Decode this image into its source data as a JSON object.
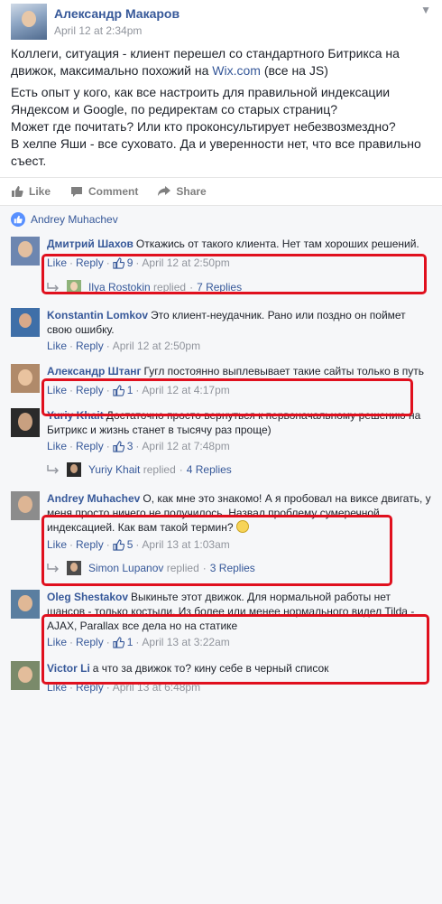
{
  "post": {
    "author": "Александр Макаров",
    "time": "April 12 at 2:34pm",
    "paragraph1_before_link": "Коллеги, ситуация - клиент перешел со стандартного Битрикса на движок, максимально похожий на ",
    "paragraph1_link": "Wix.com",
    "paragraph1_after_link": " (все на JS)",
    "paragraph2": "Есть опыт у кого, как все настроить для правильной индексации Яндексом и Google, по редиректам со старых страниц?",
    "paragraph3": "Может где почитать? Или кто проконсультирует небезвозмездно?",
    "paragraph4": "В хелпе Яши - все суховато. Да и уверенности нет, что все правильно съест.",
    "actions": {
      "like": "Like",
      "comment": "Comment",
      "share": "Share"
    },
    "likers": "Andrey Muhachev"
  },
  "labels": {
    "like": "Like",
    "reply": "Reply",
    "replied": "replied"
  },
  "comments": [
    {
      "name": "Дмитрий Шахов",
      "text": "Откажись от такого клиента. Нет там хороших решений.",
      "likes": "9",
      "time": "April 12 at 2:50pm",
      "reply": {
        "name": "Ilya Rostokin",
        "count": "7 Replies"
      }
    },
    {
      "name": "Konstantin Lomkov",
      "text": "Это клиент-неудачник. Рано или поздно он поймет свою ошибку.",
      "time": "April 12 at 2:50pm"
    },
    {
      "name": "Александр Штанг",
      "text": "Гугл постоянно выплевывает такие сайты только в путь",
      "likes": "1",
      "time": "April 12 at 4:17pm"
    },
    {
      "name": "Yuriy Khait",
      "text": "Достаточно просто вернуться к первоначальному решению на Битрикс и жизнь станет в тысячу раз проще)",
      "likes": "3",
      "time": "April 12 at 7:48pm",
      "reply": {
        "name": "Yuriy Khait",
        "count": "4 Replies"
      }
    },
    {
      "name": "Andrey Muhachev",
      "text": "О, как мне это знакомо! А я пробовал на виксе двигать, у меня просто ничего не получилось. Назвал проблему сумеречной индексацией. Как вам такой термин?",
      "likes": "5",
      "time": "April 13 at 1:03am",
      "reply": {
        "name": "Simon Lupanov",
        "count": "3 Replies"
      }
    },
    {
      "name": "Oleg Shestakov",
      "text": "Выкиньте этот движок. Для нормальной работы нет шансов - только костыли. Из более или менее нормального видел Tilda - AJAX, Parallax все дела но на статике",
      "likes": "1",
      "time": "April 13 at 3:22am"
    },
    {
      "name": "Victor Li",
      "text": "а что за движок то? кину себе в черный список",
      "time": "April 13 at 6:48pm"
    }
  ]
}
